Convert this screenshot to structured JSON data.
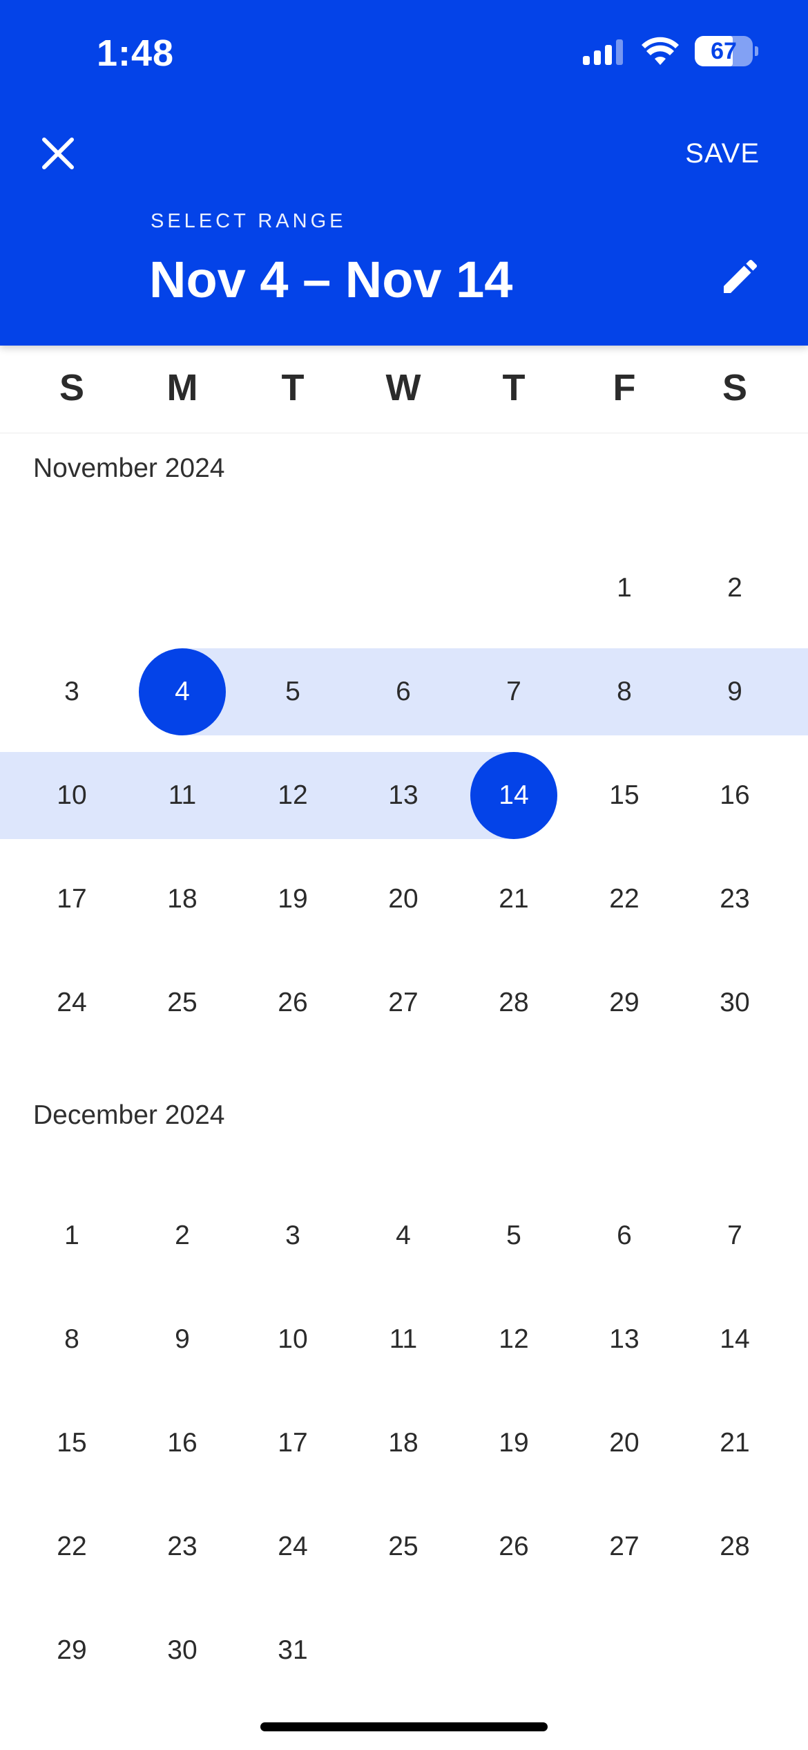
{
  "status_bar": {
    "time": "1:48",
    "battery": "67"
  },
  "header": {
    "save_label": "SAVE",
    "range_label": "SELECT RANGE",
    "range_value": "Nov 4 – Nov 14"
  },
  "weekdays": [
    "S",
    "M",
    "T",
    "W",
    "T",
    "F",
    "S"
  ],
  "colors": {
    "accent": "#0443e8",
    "range_band": "#dde6fc",
    "text": "#2b2b2b"
  },
  "selection": {
    "start": "Nov 4",
    "end": "Nov 14"
  },
  "months": [
    {
      "title": "November 2024",
      "weeks": [
        [
          "",
          "",
          "",
          "",
          "",
          "1",
          "2"
        ],
        [
          "3",
          "4",
          "5",
          "6",
          "7",
          "8",
          "9"
        ],
        [
          "10",
          "11",
          "12",
          "13",
          "14",
          "15",
          "16"
        ],
        [
          "17",
          "18",
          "19",
          "20",
          "21",
          "22",
          "23"
        ],
        [
          "24",
          "25",
          "26",
          "27",
          "28",
          "29",
          "30"
        ]
      ]
    },
    {
      "title": "December 2024",
      "weeks": [
        [
          "1",
          "2",
          "3",
          "4",
          "5",
          "6",
          "7"
        ],
        [
          "8",
          "9",
          "10",
          "11",
          "12",
          "13",
          "14"
        ],
        [
          "15",
          "16",
          "17",
          "18",
          "19",
          "20",
          "21"
        ],
        [
          "22",
          "23",
          "24",
          "25",
          "26",
          "27",
          "28"
        ],
        [
          "29",
          "30",
          "31",
          "",
          "",
          "",
          ""
        ]
      ]
    }
  ]
}
